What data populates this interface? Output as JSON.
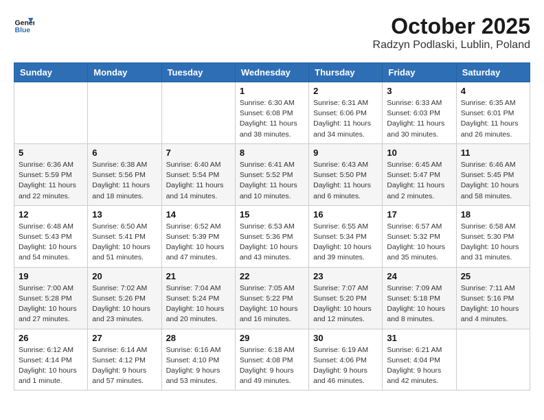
{
  "header": {
    "logo_line1": "General",
    "logo_line2": "Blue",
    "month": "October 2025",
    "location": "Radzyn Podlaski, Lublin, Poland"
  },
  "days_of_week": [
    "Sunday",
    "Monday",
    "Tuesday",
    "Wednesday",
    "Thursday",
    "Friday",
    "Saturday"
  ],
  "weeks": [
    [
      {
        "day": null,
        "info": null
      },
      {
        "day": null,
        "info": null
      },
      {
        "day": null,
        "info": null
      },
      {
        "day": "1",
        "info": "Sunrise: 6:30 AM\nSunset: 6:08 PM\nDaylight: 11 hours\nand 38 minutes."
      },
      {
        "day": "2",
        "info": "Sunrise: 6:31 AM\nSunset: 6:06 PM\nDaylight: 11 hours\nand 34 minutes."
      },
      {
        "day": "3",
        "info": "Sunrise: 6:33 AM\nSunset: 6:03 PM\nDaylight: 11 hours\nand 30 minutes."
      },
      {
        "day": "4",
        "info": "Sunrise: 6:35 AM\nSunset: 6:01 PM\nDaylight: 11 hours\nand 26 minutes."
      }
    ],
    [
      {
        "day": "5",
        "info": "Sunrise: 6:36 AM\nSunset: 5:59 PM\nDaylight: 11 hours\nand 22 minutes."
      },
      {
        "day": "6",
        "info": "Sunrise: 6:38 AM\nSunset: 5:56 PM\nDaylight: 11 hours\nand 18 minutes."
      },
      {
        "day": "7",
        "info": "Sunrise: 6:40 AM\nSunset: 5:54 PM\nDaylight: 11 hours\nand 14 minutes."
      },
      {
        "day": "8",
        "info": "Sunrise: 6:41 AM\nSunset: 5:52 PM\nDaylight: 11 hours\nand 10 minutes."
      },
      {
        "day": "9",
        "info": "Sunrise: 6:43 AM\nSunset: 5:50 PM\nDaylight: 11 hours\nand 6 minutes."
      },
      {
        "day": "10",
        "info": "Sunrise: 6:45 AM\nSunset: 5:47 PM\nDaylight: 11 hours\nand 2 minutes."
      },
      {
        "day": "11",
        "info": "Sunrise: 6:46 AM\nSunset: 5:45 PM\nDaylight: 10 hours\nand 58 minutes."
      }
    ],
    [
      {
        "day": "12",
        "info": "Sunrise: 6:48 AM\nSunset: 5:43 PM\nDaylight: 10 hours\nand 54 minutes."
      },
      {
        "day": "13",
        "info": "Sunrise: 6:50 AM\nSunset: 5:41 PM\nDaylight: 10 hours\nand 51 minutes."
      },
      {
        "day": "14",
        "info": "Sunrise: 6:52 AM\nSunset: 5:39 PM\nDaylight: 10 hours\nand 47 minutes."
      },
      {
        "day": "15",
        "info": "Sunrise: 6:53 AM\nSunset: 5:36 PM\nDaylight: 10 hours\nand 43 minutes."
      },
      {
        "day": "16",
        "info": "Sunrise: 6:55 AM\nSunset: 5:34 PM\nDaylight: 10 hours\nand 39 minutes."
      },
      {
        "day": "17",
        "info": "Sunrise: 6:57 AM\nSunset: 5:32 PM\nDaylight: 10 hours\nand 35 minutes."
      },
      {
        "day": "18",
        "info": "Sunrise: 6:58 AM\nSunset: 5:30 PM\nDaylight: 10 hours\nand 31 minutes."
      }
    ],
    [
      {
        "day": "19",
        "info": "Sunrise: 7:00 AM\nSunset: 5:28 PM\nDaylight: 10 hours\nand 27 minutes."
      },
      {
        "day": "20",
        "info": "Sunrise: 7:02 AM\nSunset: 5:26 PM\nDaylight: 10 hours\nand 23 minutes."
      },
      {
        "day": "21",
        "info": "Sunrise: 7:04 AM\nSunset: 5:24 PM\nDaylight: 10 hours\nand 20 minutes."
      },
      {
        "day": "22",
        "info": "Sunrise: 7:05 AM\nSunset: 5:22 PM\nDaylight: 10 hours\nand 16 minutes."
      },
      {
        "day": "23",
        "info": "Sunrise: 7:07 AM\nSunset: 5:20 PM\nDaylight: 10 hours\nand 12 minutes."
      },
      {
        "day": "24",
        "info": "Sunrise: 7:09 AM\nSunset: 5:18 PM\nDaylight: 10 hours\nand 8 minutes."
      },
      {
        "day": "25",
        "info": "Sunrise: 7:11 AM\nSunset: 5:16 PM\nDaylight: 10 hours\nand 4 minutes."
      }
    ],
    [
      {
        "day": "26",
        "info": "Sunrise: 6:12 AM\nSunset: 4:14 PM\nDaylight: 10 hours\nand 1 minute."
      },
      {
        "day": "27",
        "info": "Sunrise: 6:14 AM\nSunset: 4:12 PM\nDaylight: 9 hours\nand 57 minutes."
      },
      {
        "day": "28",
        "info": "Sunrise: 6:16 AM\nSunset: 4:10 PM\nDaylight: 9 hours\nand 53 minutes."
      },
      {
        "day": "29",
        "info": "Sunrise: 6:18 AM\nSunset: 4:08 PM\nDaylight: 9 hours\nand 49 minutes."
      },
      {
        "day": "30",
        "info": "Sunrise: 6:19 AM\nSunset: 4:06 PM\nDaylight: 9 hours\nand 46 minutes."
      },
      {
        "day": "31",
        "info": "Sunrise: 6:21 AM\nSunset: 4:04 PM\nDaylight: 9 hours\nand 42 minutes."
      },
      {
        "day": null,
        "info": null
      }
    ]
  ]
}
